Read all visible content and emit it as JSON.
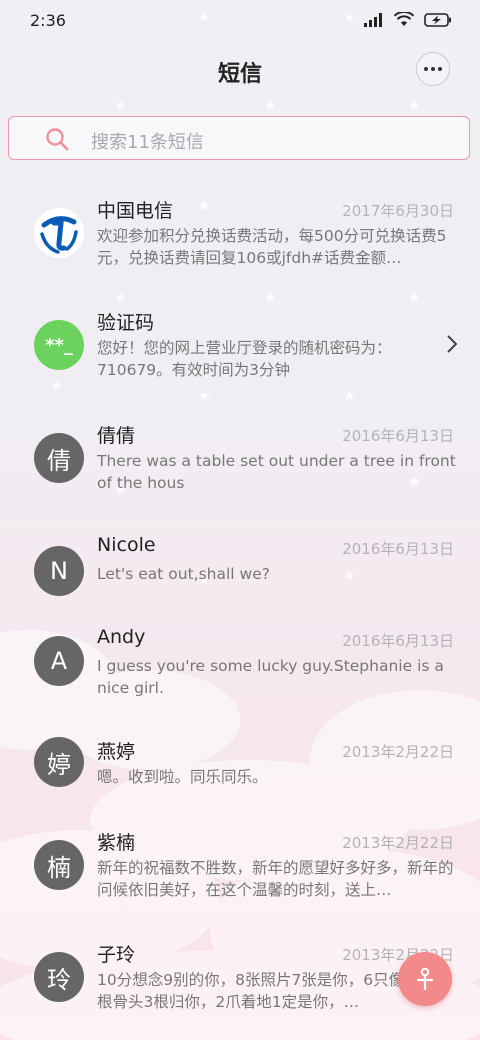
{
  "status_bar": {
    "time": "2:36"
  },
  "header": {
    "title": "短信"
  },
  "search": {
    "placeholder": "搜索11条短信"
  },
  "messages": [
    {
      "name": "中国电信",
      "date": "2017年6月30日",
      "preview": "欢迎参加积分兑换话费活动，每500分可兑换话费5元，兑换话费请回复106或jfdh#话费金额…",
      "avatar": "",
      "avatar_type": "telecom-logo"
    },
    {
      "name": "验证码",
      "date": "",
      "preview": "您好！您的网上营业厅登录的随机密码为：710679。有效时间为3分钟",
      "avatar": "**_",
      "avatar_type": "code"
    },
    {
      "name": "倩倩",
      "date": "2016年6月13日",
      "preview": "There was a table set out under a tree in front of the hous",
      "avatar": "倩",
      "avatar_type": "letter"
    },
    {
      "name": "Nicole",
      "date": "2016年6月13日",
      "preview": "Let's eat out,shall we?",
      "avatar": "N",
      "avatar_type": "letter"
    },
    {
      "name": "Andy",
      "date": "2016年6月13日",
      "preview": "I guess you're some lucky guy.Stephanie is a nice girl.",
      "avatar": "A",
      "avatar_type": "letter"
    },
    {
      "name": "燕婷",
      "date": "2013年2月22日",
      "preview": "嗯。收到啦。同乐同乐。",
      "avatar": "婷",
      "avatar_type": "letter"
    },
    {
      "name": "紫楠",
      "date": "2013年2月22日",
      "preview": "新年的祝福数不胜数，新年的愿望好多好多，新年的问候依旧美好，在这个温馨的时刻，送上…",
      "avatar": "楠",
      "avatar_type": "letter"
    },
    {
      "name": "子玲",
      "date": "2013年2月22日",
      "preview": "10分想念9别的你，8张照片7张是你，6只像你，4根骨头3根归你，2爪着地1定是你，…",
      "avatar": "玲",
      "avatar_type": "letter"
    }
  ],
  "colors": {
    "accent": "#f28a8c",
    "search_border": "#ec9aa8",
    "code_avatar": "#6cd25e",
    "letter_avatar": "#666666",
    "telecom_blue": "#0a5bb5"
  },
  "icons": {
    "signal": "signal-icon",
    "wifi": "wifi-icon",
    "battery": "battery-charging-icon",
    "more": "more-icon",
    "search": "search-icon",
    "chevron": "chevron-right-icon",
    "compose": "compose-icon"
  }
}
